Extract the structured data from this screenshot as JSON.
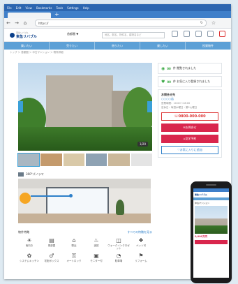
{
  "browser": {
    "menu": [
      "File",
      "Edit",
      "View",
      "Bookmarks",
      "Tools",
      "Settings",
      "Help"
    ],
    "url": "https://",
    "new_tab": "+"
  },
  "site": {
    "logo_tag": "東急リバブル",
    "logo_name": "東急リバブル",
    "area_select": "首都圏 ▼",
    "search_placeholder": "地名、駅名、物件名、建物名など",
    "gnav": [
      "買いたい",
      "売りたい",
      "借りたい",
      "貸したい",
      "投資物件"
    ]
  },
  "breadcrumb": "トップ ＞ 首都圏 ＞ 中古マンション ＞ 物件詳細",
  "photo": {
    "pager": "1/20"
  },
  "favorites": [
    {
      "count": "00",
      "text": "件 閲覧されました"
    },
    {
      "count": "00",
      "text": "件 お気に入り登録されました"
    }
  ],
  "store": {
    "title": "お問合せ先",
    "link": "○○○○店",
    "hours": "営業時間：10:00〜18:00",
    "holiday": "定休日：毎週水曜日・第2火曜日"
  },
  "phone": "0800-000-000",
  "buttons": {
    "inquiry": "お問合せ",
    "visit": "見学予約",
    "favorite": "お気に入りに追加"
  },
  "view360": {
    "label": "360°パノラマ"
  },
  "features": {
    "title": "物件特徴",
    "more": "すべての特徴を見る",
    "items": [
      {
        "icon": "☀",
        "label": "南向き"
      },
      {
        "icon": "▤",
        "label": "角部屋"
      },
      {
        "icon": "⌂",
        "label": "駅近"
      },
      {
        "icon": "♨",
        "label": "追焚"
      },
      {
        "icon": "◫",
        "label": "ウォークインクロゼット"
      },
      {
        "icon": "✚",
        "label": "ペット可"
      },
      {
        "icon": "✿",
        "label": "システムキッチン"
      },
      {
        "icon": "♂",
        "label": "宅配ボックス"
      },
      {
        "icon": "⚿",
        "label": "オートロック"
      },
      {
        "icon": "▣",
        "label": "モニター付"
      },
      {
        "icon": "◔",
        "label": "駐車場"
      },
      {
        "icon": "⚑",
        "label": "リフォーム"
      }
    ]
  },
  "smartphone": {
    "brand": "東急リバブル",
    "title": "中古マンション",
    "price": "0,000万円",
    "button": "お問合せ"
  }
}
